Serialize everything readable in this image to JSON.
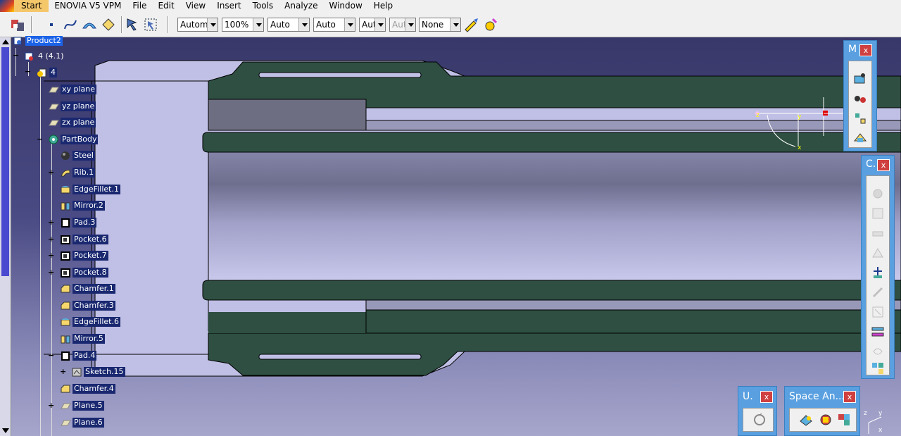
{
  "menu": {
    "start": "Start",
    "workbench": "ENOVIA V5 VPM",
    "file": "File",
    "edit": "Edit",
    "view": "View",
    "insert": "Insert",
    "tools": "Tools",
    "analyze": "Analyze",
    "window": "Window",
    "help": "Help"
  },
  "toolbar": {
    "combo1": "Automa",
    "combo2": "100%",
    "combo3": "Auto",
    "combo4": "Auto",
    "combo5": "Aut",
    "combo6": "Aut",
    "combo7": "None"
  },
  "tree": {
    "root": "Product2",
    "instance": "4 (4.1)",
    "part": "4",
    "items": [
      {
        "label": "xy plane"
      },
      {
        "label": "yz plane"
      },
      {
        "label": "zx plane"
      },
      {
        "label": "PartBody"
      },
      {
        "label": "Steel"
      },
      {
        "label": "Rib.1"
      },
      {
        "label": "EdgeFillet.1"
      },
      {
        "label": "Mirror.2"
      },
      {
        "label": "Pad.3"
      },
      {
        "label": "Pocket.6"
      },
      {
        "label": "Pocket.7"
      },
      {
        "label": "Pocket.8"
      },
      {
        "label": "Chamfer.1"
      },
      {
        "label": "Chamfer.3"
      },
      {
        "label": "EdgeFillet.6"
      },
      {
        "label": "Mirror.5"
      },
      {
        "label": "Pad.4"
      },
      {
        "label": "Sketch.15"
      },
      {
        "label": "Chamfer.4"
      },
      {
        "label": "Plane.5"
      },
      {
        "label": "Plane.6"
      }
    ]
  },
  "float_toolbars": {
    "m": {
      "title": "M",
      "close": "x"
    },
    "c": {
      "title": "C.",
      "close": "x"
    },
    "u": {
      "title": "U.",
      "close": "x"
    },
    "space": {
      "title": "Space An...",
      "close": "x"
    }
  },
  "axes": {
    "z": "z",
    "y": "y",
    "x": "x"
  },
  "colors": {
    "part_green": "#2e4f42",
    "part_light": "#c0c0e6",
    "background_top": "#38386a",
    "menu_start": "#f5c76b",
    "float_toolbar": "#5aa0e0"
  }
}
